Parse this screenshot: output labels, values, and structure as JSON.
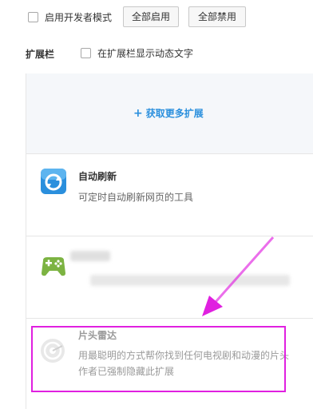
{
  "top": {
    "dev_mode_label": "启用开发者模式",
    "enable_all_label": "全部启用",
    "disable_all_label": "全部禁用"
  },
  "toolbar_section": {
    "title": "扩展栏",
    "show_text_label": "在扩展栏显示动态文字"
  },
  "get_more": {
    "plus": "+",
    "label": "获取更多扩展"
  },
  "extensions": [
    {
      "name": "自动刷新",
      "description": "可定时自动刷新网页的工具",
      "icon": "refresh-icon",
      "icon_color": "#2a8fdd"
    },
    {
      "name": "",
      "description": "",
      "icon": "gamepad-icon",
      "icon_color": "#7cb342"
    },
    {
      "name": "片头雷达",
      "description": "用最聪明的方式帮你找到任何电视剧和动漫的片头",
      "status": "作者已强制隐藏此扩展",
      "icon": "radar-icon",
      "disabled": true
    }
  ],
  "annotation": {
    "highlight_color": "#e020e0"
  }
}
